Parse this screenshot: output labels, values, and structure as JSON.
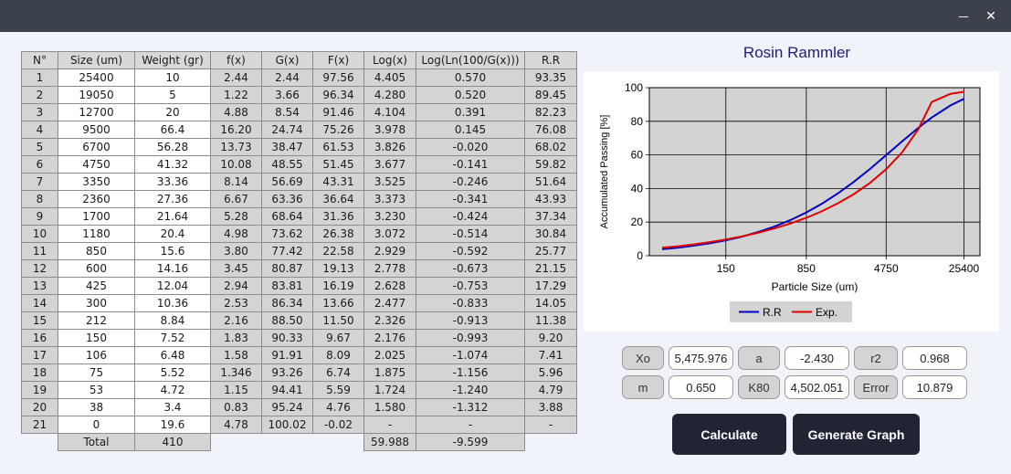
{
  "window": {
    "minimize_glyph": "—",
    "close_glyph": "✕"
  },
  "table": {
    "headers": [
      "N°",
      "Size (um)",
      "Weight (gr)",
      "f(x)",
      "G(x)",
      "F(x)",
      "Log(x)",
      "Log(Ln(100/G(x)))",
      "R.R"
    ],
    "rows": [
      [
        "1",
        "25400",
        "10",
        "2.44",
        "2.44",
        "97.56",
        "4.405",
        "0.570",
        "93.35"
      ],
      [
        "2",
        "19050",
        "5",
        "1.22",
        "3.66",
        "96.34",
        "4.280",
        "0.520",
        "89.45"
      ],
      [
        "3",
        "12700",
        "20",
        "4.88",
        "8.54",
        "91.46",
        "4.104",
        "0.391",
        "82.23"
      ],
      [
        "4",
        "9500",
        "66.4",
        "16.20",
        "24.74",
        "75.26",
        "3.978",
        "0.145",
        "76.08"
      ],
      [
        "5",
        "6700",
        "56.28",
        "13.73",
        "38.47",
        "61.53",
        "3.826",
        "-0.020",
        "68.02"
      ],
      [
        "6",
        "4750",
        "41.32",
        "10.08",
        "48.55",
        "51.45",
        "3.677",
        "-0.141",
        "59.82"
      ],
      [
        "7",
        "3350",
        "33.36",
        "8.14",
        "56.69",
        "43.31",
        "3.525",
        "-0.246",
        "51.64"
      ],
      [
        "8",
        "2360",
        "27.36",
        "6.67",
        "63.36",
        "36.64",
        "3.373",
        "-0.341",
        "43.93"
      ],
      [
        "9",
        "1700",
        "21.64",
        "5.28",
        "68.64",
        "31.36",
        "3.230",
        "-0.424",
        "37.34"
      ],
      [
        "10",
        "1180",
        "20.4",
        "4.98",
        "73.62",
        "26.38",
        "3.072",
        "-0.514",
        "30.84"
      ],
      [
        "11",
        "850",
        "15.6",
        "3.80",
        "77.42",
        "22.58",
        "2.929",
        "-0.592",
        "25.77"
      ],
      [
        "12",
        "600",
        "14.16",
        "3.45",
        "80.87",
        "19.13",
        "2.778",
        "-0.673",
        "21.15"
      ],
      [
        "13",
        "425",
        "12.04",
        "2.94",
        "83.81",
        "16.19",
        "2.628",
        "-0.753",
        "17.29"
      ],
      [
        "14",
        "300",
        "10.36",
        "2.53",
        "86.34",
        "13.66",
        "2.477",
        "-0.833",
        "14.05"
      ],
      [
        "15",
        "212",
        "8.84",
        "2.16",
        "88.50",
        "11.50",
        "2.326",
        "-0.913",
        "11.38"
      ],
      [
        "16",
        "150",
        "7.52",
        "1.83",
        "90.33",
        "9.67",
        "2.176",
        "-0.993",
        "9.20"
      ],
      [
        "17",
        "106",
        "6.48",
        "1.58",
        "91.91",
        "8.09",
        "2.025",
        "-1.074",
        "7.41"
      ],
      [
        "18",
        "75",
        "5.52",
        "1.346",
        "93.26",
        "6.74",
        "1.875",
        "-1.156",
        "5.96"
      ],
      [
        "19",
        "53",
        "4.72",
        "1.15",
        "94.41",
        "5.59",
        "1.724",
        "-1.240",
        "4.79"
      ],
      [
        "20",
        "38",
        "3.4",
        "0.83",
        "95.24",
        "4.76",
        "1.580",
        "-1.312",
        "3.88"
      ],
      [
        "21",
        "0",
        "19.6",
        "4.78",
        "100.02",
        "-0.02",
        "-",
        "-",
        "-"
      ]
    ],
    "footer": {
      "total_label": "Total",
      "weight_total": "410",
      "log_total": "59.988",
      "loglog_total": "-9.599"
    }
  },
  "chart_data": {
    "type": "line",
    "title": "Rosin Rammler",
    "xlabel": "Particle Size (um)",
    "ylabel": "Accumulated Passing [%]",
    "x_scale": "log",
    "x_ticks": [
      "150",
      "850",
      "4750",
      "25400"
    ],
    "y_ticks": [
      "0",
      "20",
      "40",
      "60",
      "80",
      "100"
    ],
    "ylim": [
      0,
      100
    ],
    "grid": true,
    "legend_position": "bottom",
    "x": [
      38,
      53,
      75,
      106,
      150,
      212,
      300,
      425,
      600,
      850,
      1180,
      1700,
      2360,
      3350,
      4750,
      6700,
      9500,
      12700,
      19050,
      25400
    ],
    "series": [
      {
        "name": "R.R",
        "color": "#0000c0",
        "values": [
          3.88,
          4.79,
          5.96,
          7.41,
          9.2,
          11.38,
          14.05,
          17.29,
          21.15,
          25.77,
          30.84,
          37.34,
          43.93,
          51.64,
          59.82,
          68.02,
          76.08,
          82.23,
          89.45,
          93.35
        ]
      },
      {
        "name": "Exp.",
        "color": "#e00000",
        "values": [
          4.76,
          5.59,
          6.74,
          8.09,
          9.67,
          11.5,
          13.66,
          16.19,
          19.13,
          22.58,
          26.38,
          31.36,
          36.64,
          43.31,
          51.45,
          61.53,
          75.26,
          91.46,
          96.34,
          97.56
        ]
      }
    ]
  },
  "params": {
    "xo_label": "Xo",
    "xo_value": "5,475.976",
    "a_label": "a",
    "a_value": "-2.430",
    "r2_label": "r2",
    "r2_value": "0.968",
    "m_label": "m",
    "m_value": "0.650",
    "k80_label": "K80",
    "k80_value": "4,502.051",
    "error_label": "Error",
    "error_value": "10.879"
  },
  "buttons": {
    "calculate": "Calculate",
    "generate_graph": "Generate Graph"
  }
}
